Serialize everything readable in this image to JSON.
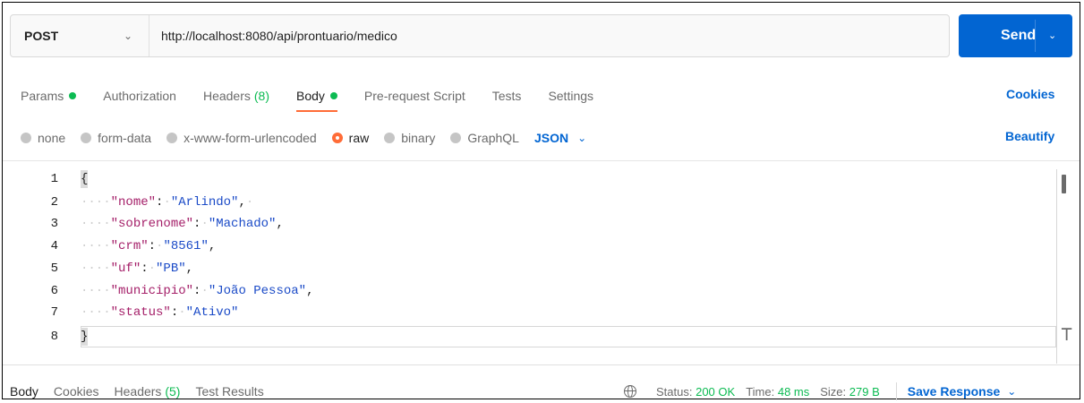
{
  "request": {
    "method": "POST",
    "url": "http://localhost:8080/api/prontuario/medico",
    "send_label": "Send"
  },
  "tabs": [
    {
      "label": "Params",
      "indicator": "dot"
    },
    {
      "label": "Authorization"
    },
    {
      "label": "Headers",
      "count": "(8)"
    },
    {
      "label": "Body",
      "indicator": "dot",
      "active": true
    },
    {
      "label": "Pre-request Script"
    },
    {
      "label": "Tests"
    },
    {
      "label": "Settings"
    }
  ],
  "cookies_label": "Cookies",
  "body_types": [
    "none",
    "form-data",
    "x-www-form-urlencoded",
    "raw",
    "binary",
    "GraphQL"
  ],
  "body_type_selected": "raw",
  "format": "JSON",
  "beautify_label": "Beautify",
  "editor": {
    "line_numbers": [
      "1",
      "2",
      "3",
      "4",
      "5",
      "6",
      "7",
      "8"
    ],
    "lines": [
      {
        "open": "{"
      },
      {
        "key": "\"nome\"",
        "value": "\"Arlindo\"",
        "trail": ",",
        "trail_ws": true
      },
      {
        "key": "\"sobrenome\"",
        "value": "\"Machado\"",
        "trail": ","
      },
      {
        "key": "\"crm\"",
        "value": "\"8561\"",
        "trail": ","
      },
      {
        "key": "\"uf\"",
        "value": "\"PB\"",
        "trail": ","
      },
      {
        "key": "\"municipio\"",
        "value": "\"João Pessoa\"",
        "trail": ","
      },
      {
        "key": "\"status\"",
        "value": "\"Ativo\"",
        "trail": ""
      },
      {
        "open": "}"
      }
    ]
  },
  "response": {
    "tabs": [
      {
        "label": "Body",
        "active": true
      },
      {
        "label": "Cookies"
      },
      {
        "label": "Headers",
        "count": "(5)"
      },
      {
        "label": "Test Results"
      }
    ],
    "status_label": "Status:",
    "status_value": "200 OK",
    "time_label": "Time:",
    "time_value": "48 ms",
    "size_label": "Size:",
    "size_value": "279 B",
    "save_label": "Save Response"
  },
  "colors": {
    "accent_blue": "#0265d2",
    "accent_orange": "#ff6c37",
    "success_green": "#0cbb52"
  }
}
